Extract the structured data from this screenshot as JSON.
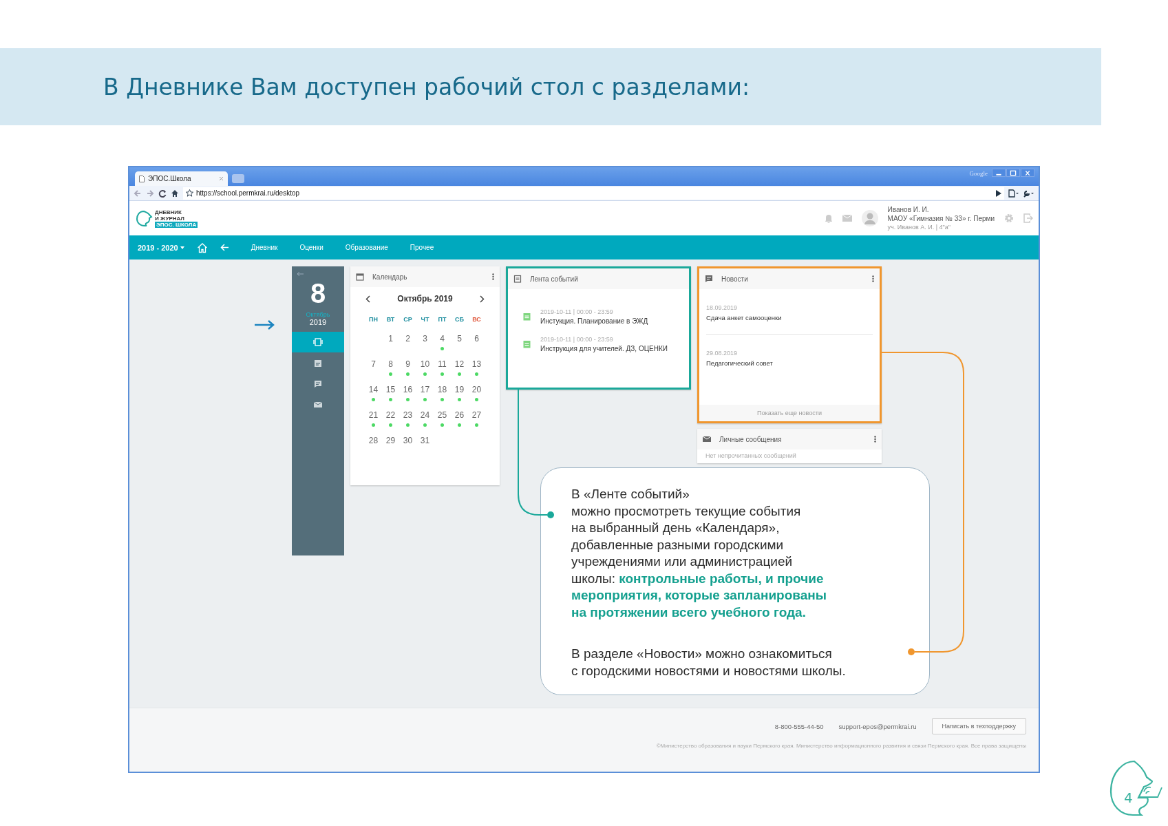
{
  "slide": {
    "title": "В Дневнике Вам доступен рабочий стол с разделами:",
    "page_number": "4"
  },
  "browser": {
    "tabs": [
      {
        "label": "ЭПОС.Школа",
        "selected": true
      }
    ],
    "brand": "Google",
    "url": "https://school.permkrai.ru/desktop"
  },
  "app": {
    "logo": {
      "line_1": "ДНЕВНИК",
      "line_2": "И ЖУРНАЛ",
      "line_3": "ЭПОС. ШКОЛА"
    },
    "user": {
      "name": "Иванов И. И.",
      "school": "МАОУ «Гимназия № 33» г. Перми",
      "role": "уч. Иванов А. И. | 4\"а\""
    },
    "nav": {
      "year": "2019 - 2020",
      "items": [
        {
          "label": "Дневник"
        },
        {
          "label": "Оценки"
        },
        {
          "label": "Образование"
        },
        {
          "label": "Прочее"
        }
      ]
    }
  },
  "sidebar": {
    "day": "8",
    "month": "Октябрь",
    "year": "2019",
    "items": [
      {
        "kind": "desktop",
        "selected": true
      },
      {
        "kind": "calendar",
        "selected": false
      },
      {
        "kind": "news",
        "selected": false
      },
      {
        "kind": "messages",
        "selected": false
      }
    ]
  },
  "calendar": {
    "title": "Календарь",
    "month": "Октябрь 2019",
    "weekdays": [
      {
        "label": "ПН",
        "weekend": false
      },
      {
        "label": "ВТ",
        "weekend": false
      },
      {
        "label": "СР",
        "weekend": false
      },
      {
        "label": "ЧТ",
        "weekend": false
      },
      {
        "label": "ПТ",
        "weekend": false
      },
      {
        "label": "СБ",
        "weekend": false
      },
      {
        "label": "ВС",
        "weekend": true
      }
    ],
    "weeks": [
      [
        {
          "kind": "blank"
        },
        {
          "kind": "day",
          "day": "1",
          "events": false
        },
        {
          "kind": "day",
          "day": "2",
          "events": false
        },
        {
          "kind": "day",
          "day": "3",
          "events": false
        },
        {
          "kind": "day",
          "day": "4",
          "events": true
        },
        {
          "kind": "day",
          "day": "5",
          "events": false
        },
        {
          "kind": "day",
          "day": "6",
          "events": false
        }
      ],
      [
        {
          "kind": "day",
          "day": "7",
          "events": false
        },
        {
          "kind": "day",
          "day": "8",
          "events": true
        },
        {
          "kind": "day",
          "day": "9",
          "events": true
        },
        {
          "kind": "day",
          "day": "10",
          "events": true
        },
        {
          "kind": "day",
          "day": "11",
          "events": true
        },
        {
          "kind": "day",
          "day": "12",
          "events": true
        },
        {
          "kind": "day",
          "day": "13",
          "events": true
        }
      ],
      [
        {
          "kind": "day",
          "day": "14",
          "events": true
        },
        {
          "kind": "day",
          "day": "15",
          "events": true
        },
        {
          "kind": "day",
          "day": "16",
          "events": true
        },
        {
          "kind": "day",
          "day": "17",
          "events": true
        },
        {
          "kind": "day",
          "day": "18",
          "events": true
        },
        {
          "kind": "day",
          "day": "19",
          "events": true
        },
        {
          "kind": "day",
          "day": "20",
          "events": true
        }
      ],
      [
        {
          "kind": "day",
          "day": "21",
          "events": true
        },
        {
          "kind": "day",
          "day": "22",
          "events": true
        },
        {
          "kind": "day",
          "day": "23",
          "events": true
        },
        {
          "kind": "day",
          "day": "24",
          "events": true
        },
        {
          "kind": "day",
          "day": "25",
          "events": true
        },
        {
          "kind": "day",
          "day": "26",
          "events": true
        },
        {
          "kind": "day",
          "day": "27",
          "events": true
        }
      ],
      [
        {
          "kind": "day",
          "day": "28",
          "events": false
        },
        {
          "kind": "day",
          "day": "29",
          "events": false
        },
        {
          "kind": "day",
          "day": "30",
          "events": false
        },
        {
          "kind": "day",
          "day": "31",
          "events": false
        }
      ]
    ]
  },
  "events": {
    "title": "Лента событий",
    "items": [
      {
        "time": "2019-10-11 | 00:00 - 23:59",
        "title": "Инстукция. Планирование в ЭЖД"
      },
      {
        "time": "2019-10-11 | 00:00 - 23:59",
        "title": "Инструкция для учителей. ДЗ, ОЦЕНКИ"
      }
    ]
  },
  "news": {
    "title": "Новости",
    "items": [
      {
        "date": "18.09.2019",
        "title": "Сдача анкет самооценки"
      },
      {
        "date": "29.08.2019",
        "title": "Педагогический совет"
      }
    ],
    "more": "Показать еще новости"
  },
  "messages": {
    "title": "Личные сообщения",
    "empty": "Нет непрочитанных сообщений"
  },
  "callout": {
    "paragraphs": [
      "В «Ленте событий»\nможно просмотреть текущие события\nна выбранный день «Календаря»,\nдобавленные разными городскими\nучреждениями или администрацией\nшколы: **контрольные работы, и прочие\nмероприятия, которые запланированы\nна протяжении всего учебного года.**",
      "В разделе «Новости» можно ознакомиться\nс городскими новостями и новостями школы."
    ]
  },
  "footer": {
    "phone": "8-800-555-44-50",
    "email": "support-epos@permkrai.ru",
    "button": "Написать в техподдержку",
    "copyright": "©Министерство образования и науки Пермского края. Министерство информационного развития и связи Пермского края. Все права защищены"
  }
}
